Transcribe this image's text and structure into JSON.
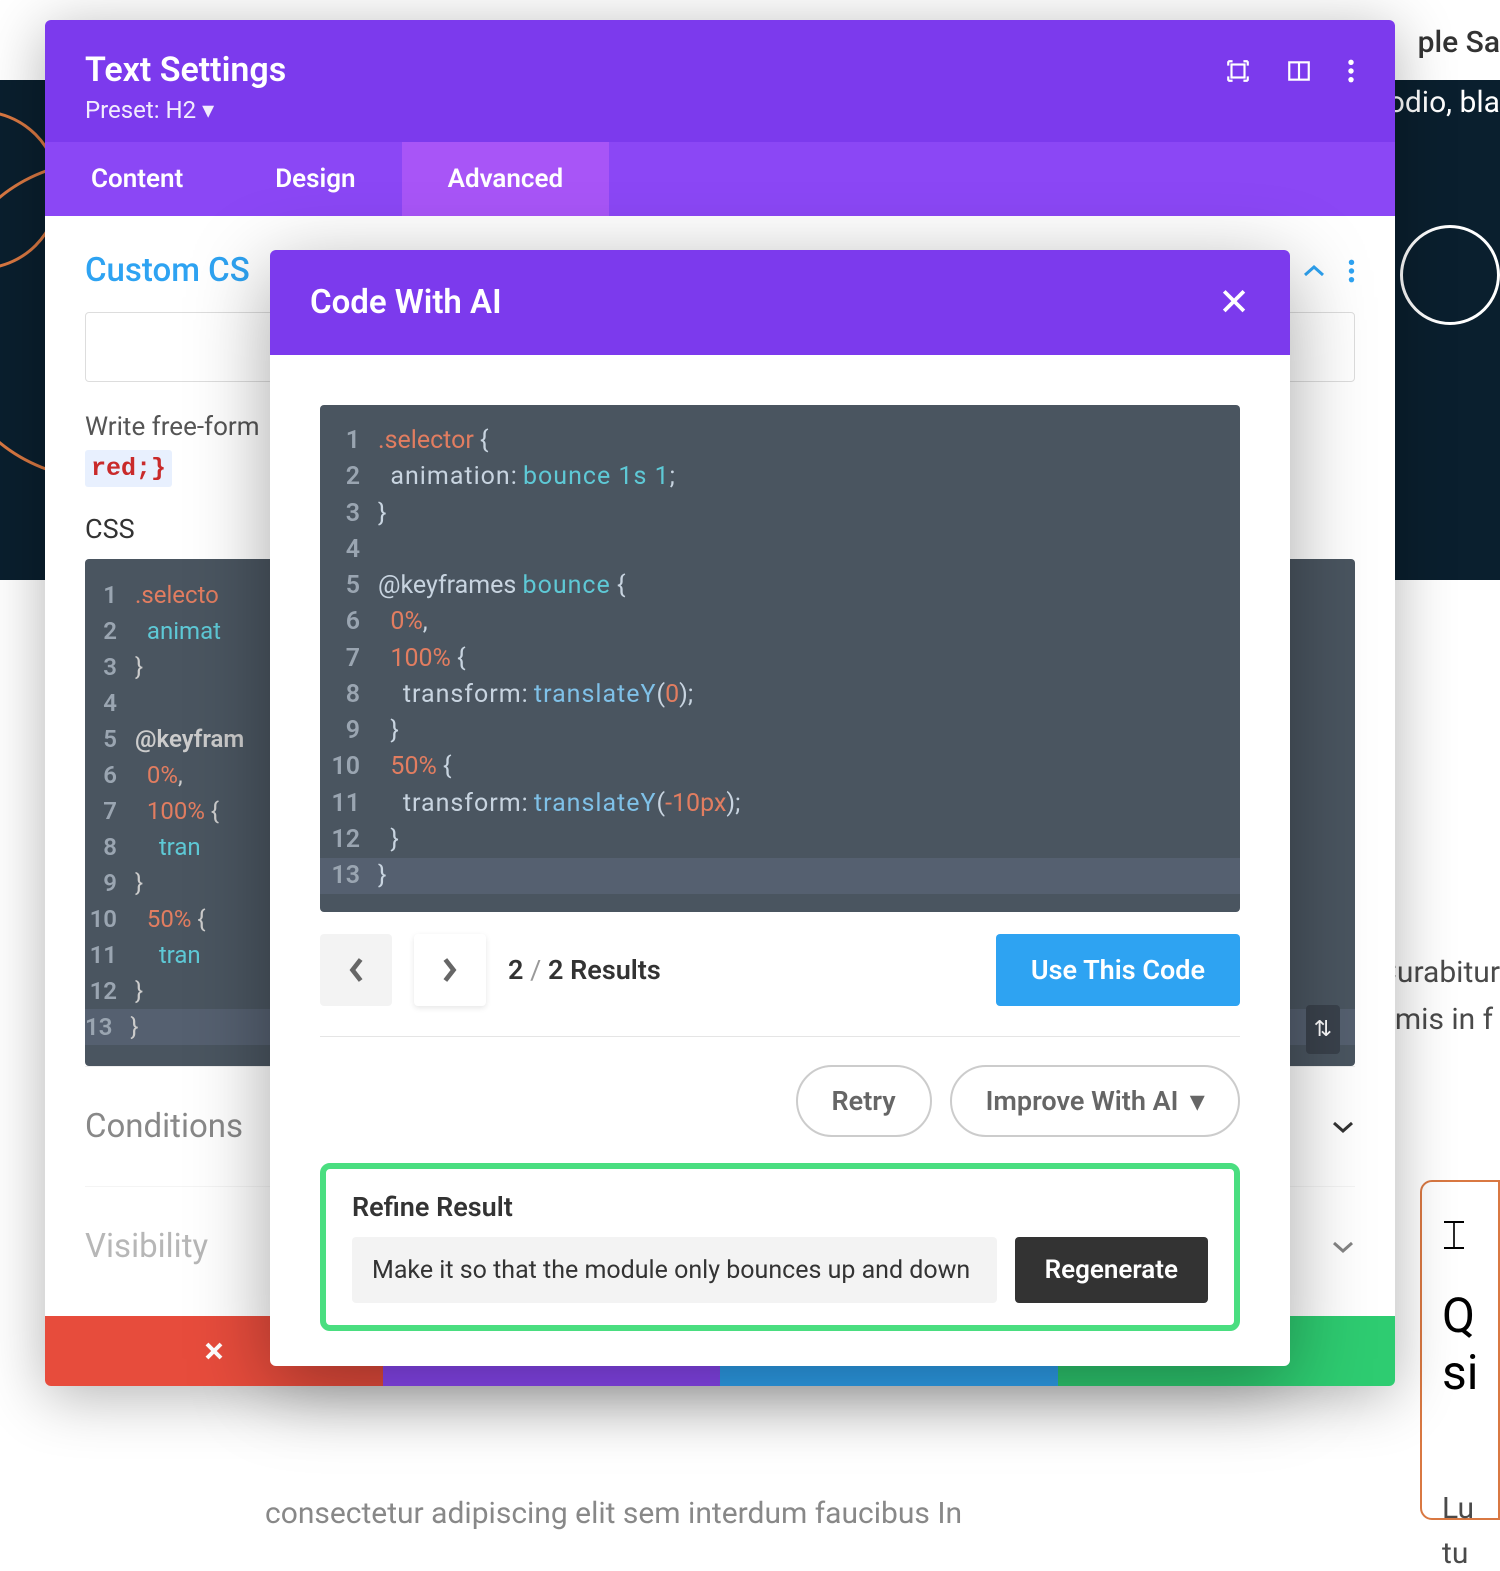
{
  "bg": {
    "right1": "ple    Sa",
    "right2": "odio, bla",
    "mid1": "Curabitur",
    "mid2": "rimis in f",
    "card_q": "Q",
    "card_si": "si",
    "card_lu": "Lu",
    "card_tu": "tu",
    "bottom": "consectetur adipiscing elit           sem interdum faucibus  In"
  },
  "panel": {
    "title": "Text Settings",
    "preset": "Preset: H2",
    "tabs": {
      "content": "Content",
      "design": "Design",
      "advanced": "Advanced"
    },
    "section_title": "Custom CS",
    "help_text": "Write free-form",
    "code_chip": "red;}",
    "css_label": "CSS",
    "conditions": "Conditions",
    "visibility": "Visibility",
    "code_lines": [
      {
        "n": "1",
        "sel": ".selecto"
      },
      {
        "n": "2",
        "prop": "animat"
      },
      {
        "n": "3",
        "txt": "}"
      },
      {
        "n": "4",
        "txt": ""
      },
      {
        "n": "5",
        "kw": "@keyfram"
      },
      {
        "n": "6",
        "num": "0%",
        "txt": ","
      },
      {
        "n": "7",
        "num": "100%",
        "txt": " {"
      },
      {
        "n": "8",
        "prop": "tran"
      },
      {
        "n": "9",
        "txt": "}"
      },
      {
        "n": "10",
        "num": "50%",
        "txt": " {"
      },
      {
        "n": "11",
        "prop": "tran"
      },
      {
        "n": "12",
        "txt": "}"
      },
      {
        "n": "13",
        "txt": "}",
        "hl": true
      }
    ]
  },
  "ai": {
    "title": "Code With AI",
    "results_current": "2",
    "results_total": "2 Results",
    "use_code": "Use This Code",
    "retry": "Retry",
    "improve": "Improve With AI",
    "refine_title": "Refine Result",
    "refine_value": "Make it so that the module only bounces up and down one",
    "regenerate": "Regenerate",
    "code": {
      "l1_sel": ".selector",
      "l1_brace": " {",
      "l2_prop": "animation",
      "l2_val": "bounce 1s 1",
      "l3": "}",
      "l5_kw": "@keyframes ",
      "l5_name": "bounce",
      "l5_brace": " {",
      "l6_num": "0%",
      "l6_comma": ",",
      "l7_num": "100%",
      "l7_brace": " {",
      "l8_prop": "transform",
      "l8_func": "translateY",
      "l8_arg": "0",
      "l9": "}",
      "l10_num": "50%",
      "l10_brace": " {",
      "l11_prop": "transform",
      "l11_func": "translateY",
      "l11_arg": "-10px",
      "l12": "}",
      "l13": "}"
    }
  }
}
